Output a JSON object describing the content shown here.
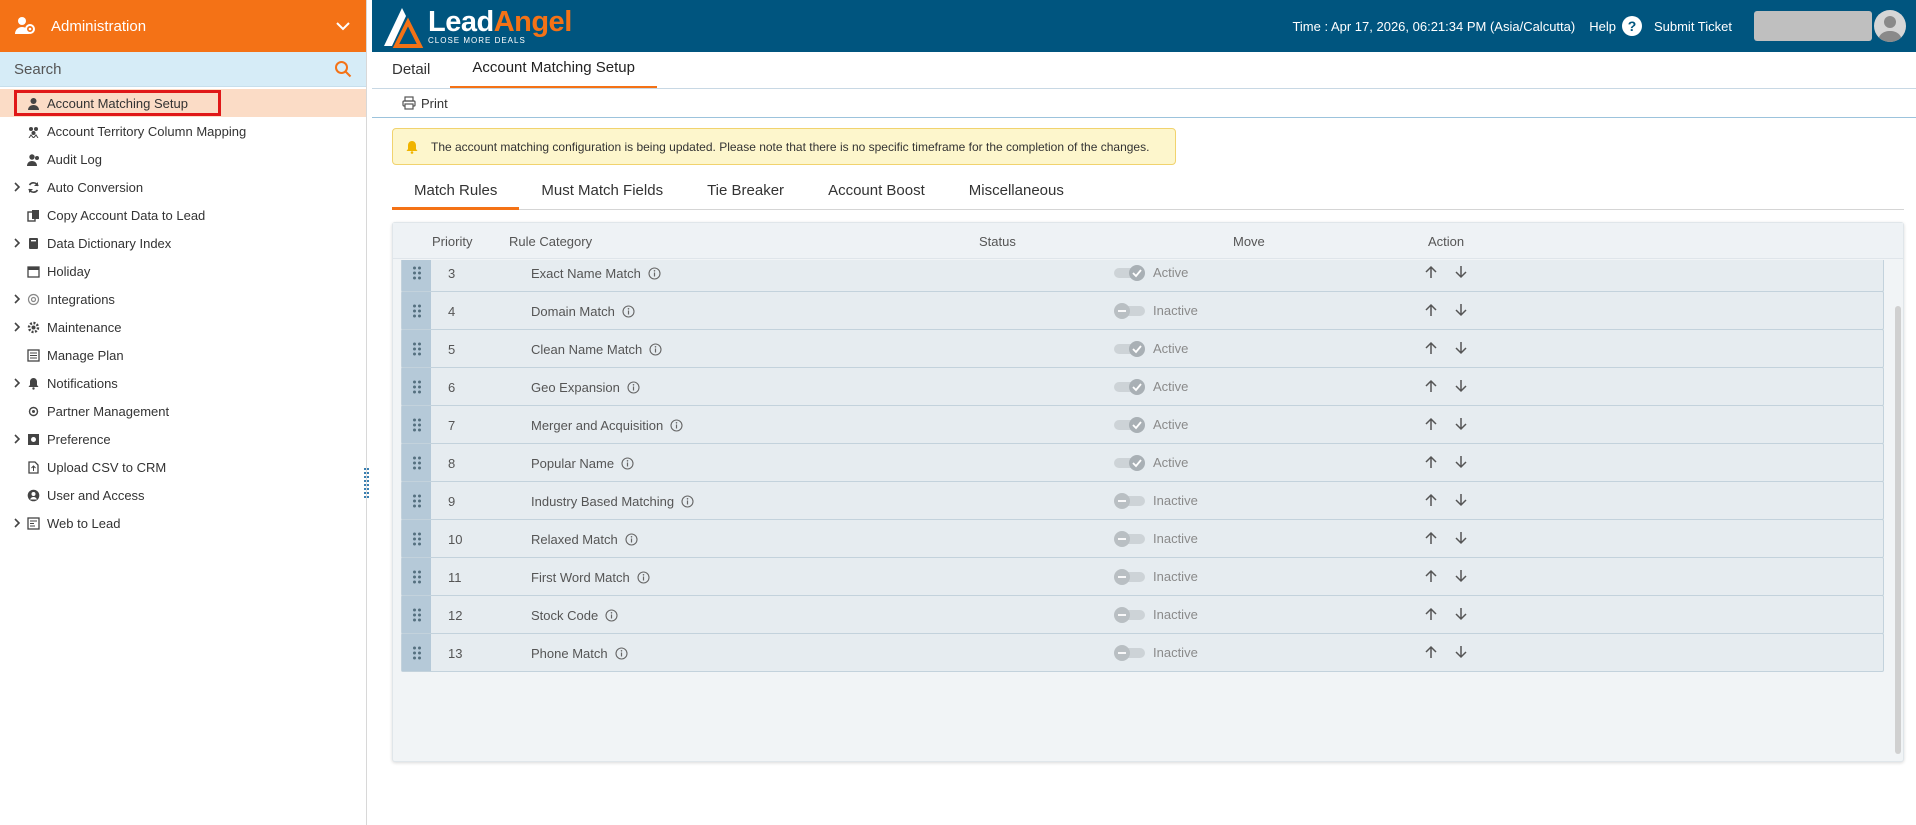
{
  "sidebar": {
    "header_title": "Administration",
    "search_placeholder": "Search",
    "items": [
      {
        "label": "Account Matching Setup",
        "icon": "user-gear-icon",
        "expandable": false,
        "active": true
      },
      {
        "label": "Account Territory Column Mapping",
        "icon": "group-icon",
        "expandable": false
      },
      {
        "label": "Audit Log",
        "icon": "users-icon",
        "expandable": false
      },
      {
        "label": "Auto Conversion",
        "icon": "refresh-icon",
        "expandable": true
      },
      {
        "label": "Copy Account Data to Lead",
        "icon": "copy-icon",
        "expandable": false
      },
      {
        "label": "Data Dictionary Index",
        "icon": "book-icon",
        "expandable": true
      },
      {
        "label": "Holiday",
        "icon": "calendar-icon",
        "expandable": false
      },
      {
        "label": "Integrations",
        "icon": "link-icon",
        "expandable": true
      },
      {
        "label": "Maintenance",
        "icon": "gear-icon",
        "expandable": true
      },
      {
        "label": "Manage Plan",
        "icon": "plan-icon",
        "expandable": false
      },
      {
        "label": "Notifications",
        "icon": "bell-icon",
        "expandable": true
      },
      {
        "label": "Partner Management",
        "icon": "cog-icon",
        "expandable": false
      },
      {
        "label": "Preference",
        "icon": "settings-box-icon",
        "expandable": true
      },
      {
        "label": "Upload CSV to CRM",
        "icon": "file-upload-icon",
        "expandable": false
      },
      {
        "label": "User and Access",
        "icon": "user-circle-icon",
        "expandable": false
      },
      {
        "label": "Web to Lead",
        "icon": "web-form-icon",
        "expandable": true
      }
    ]
  },
  "topbar": {
    "logo_lead": "Lead",
    "logo_angel": "Angel",
    "logo_tagline": "CLOSE MORE DEALS",
    "time": "Time : Apr 17, 2026, 06:21:34 PM (Asia/Calcutta)",
    "help": "Help",
    "help_glyph": "?",
    "submit_ticket": "Submit Ticket"
  },
  "main": {
    "tabs": [
      {
        "label": "Detail",
        "active": false
      },
      {
        "label": "Account Matching Setup",
        "active": true
      }
    ],
    "print_label": "Print",
    "notice": "The account matching configuration is being updated. Please note that there is no specific timeframe for the completion of the changes.",
    "subtabs": [
      {
        "label": "Match Rules",
        "active": true
      },
      {
        "label": "Must Match Fields",
        "active": false
      },
      {
        "label": "Tie Breaker",
        "active": false
      },
      {
        "label": "Account Boost",
        "active": false
      },
      {
        "label": "Miscellaneous",
        "active": false
      }
    ],
    "grid": {
      "columns": {
        "priority": "Priority",
        "rule_category": "Rule Category",
        "status": "Status",
        "move": "Move",
        "action": "Action"
      },
      "rows": [
        {
          "priority": "3",
          "rule": "Exact Name Match",
          "status": "Active"
        },
        {
          "priority": "4",
          "rule": "Domain Match",
          "status": "Inactive"
        },
        {
          "priority": "5",
          "rule": "Clean Name Match",
          "status": "Active"
        },
        {
          "priority": "6",
          "rule": "Geo Expansion",
          "status": "Active"
        },
        {
          "priority": "7",
          "rule": "Merger and Acquisition",
          "status": "Active"
        },
        {
          "priority": "8",
          "rule": "Popular Name",
          "status": "Active"
        },
        {
          "priority": "9",
          "rule": "Industry Based Matching",
          "status": "Inactive"
        },
        {
          "priority": "10",
          "rule": "Relaxed Match",
          "status": "Inactive"
        },
        {
          "priority": "11",
          "rule": "First Word Match",
          "status": "Inactive"
        },
        {
          "priority": "12",
          "rule": "Stock Code",
          "status": "Inactive"
        },
        {
          "priority": "13",
          "rule": "Phone Match",
          "status": "Inactive"
        }
      ]
    }
  },
  "colors": {
    "brand_orange": "#f47216",
    "topbar_blue": "#00557f",
    "highlight_red": "#e01818"
  }
}
